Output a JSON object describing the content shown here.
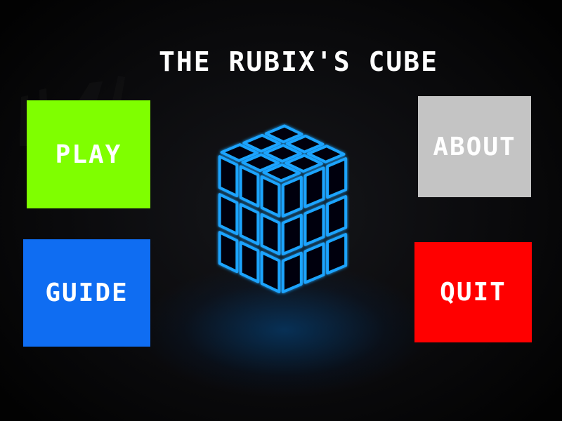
{
  "title": "THE RUBIX'S CUBE",
  "menu": {
    "play": {
      "label": "PLAY",
      "color": "#7fff00"
    },
    "guide": {
      "label": "GUIDE",
      "color": "#0f6df2"
    },
    "about": {
      "label": "ABOUT",
      "color": "#c4c4c4"
    },
    "quit": {
      "label": "QUIT",
      "color": "#ff0000"
    }
  },
  "art": {
    "cube_edge_color": "#1fa4ff",
    "cube_face_color": "#050608"
  }
}
